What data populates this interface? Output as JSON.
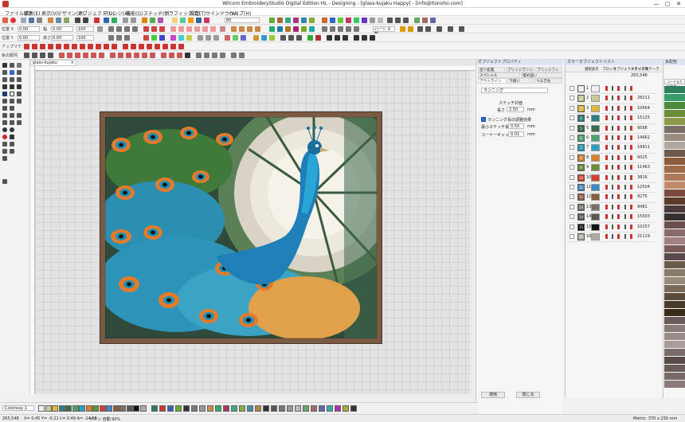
{
  "window": {
    "title": "Wilcom EmbroideryStudio Digital Edition HL - Designing - [glass-kujaku       Happy] - [info@itonoho.com]",
    "minimize": "—",
    "maximize": "▢",
    "close": "✕"
  },
  "menu": [
    "ファイル(F)",
    "編集(E)",
    "表示(V)",
    "デザイン(D)",
    "オブジェクト(O)",
    "アレンジ(A)",
    "機能(G)",
    "ステッチ(S)",
    "グラフィック(Q)",
    "設定(T)",
    "ウインドウ(W)",
    "ヘルプ(H)"
  ],
  "toolbar": {
    "pos_x_label": "位置 X",
    "pos_x_value": "0.00",
    "pos_y_label": "位置 Y",
    "pos_y_value": "0.00",
    "width_label": "幅",
    "width_value": "0.00",
    "height_label": "高さ",
    "height_value": "0.00",
    "zoom_value": "80",
    "applique_label": "アップリケ",
    "threadlist_label": "糸の順列",
    "x_axis_field": "ハート X 軸"
  },
  "document": {
    "tab_name": "glass-kujaku"
  },
  "properties_panel": {
    "title": "オブジェクトプロパティ",
    "tabs_row1": [
      "塗り処理",
      "ブリッジランニング",
      "ブリッジフィル"
    ],
    "tabs_row2": [
      "スペシャル",
      "埋め設い"
    ],
    "tabs_row3": [
      "アウトライン",
      "下縫い",
      "つなぎ糸"
    ],
    "stitch_type": "ランニング",
    "stitch_length_label": "ステッチ対値",
    "length_label": "長さ",
    "length_value": "2.50",
    "length_unit": "mm",
    "auto_adjust_label": "ランニング長の調整効果",
    "min_stitch_label": "最小ステッチ長",
    "min_stitch_value": "0.50",
    "corner_gap_label": "コーナーギャップ",
    "corner_gap_value": "0.01",
    "apply_button": "適用",
    "close_button": "閉じる"
  },
  "color_object_list": {
    "title": "カラーオブジェクトリスト",
    "columns": [
      "選択表示",
      "ブロック",
      "オブジェクトタイプ",
      "ステッチ数",
      "ステーラ"
    ],
    "total": "265,548",
    "rows": [
      {
        "n": "1",
        "color": "#efefef",
        "count": ""
      },
      {
        "n": "2",
        "color": "#c9c99a",
        "count": "28211"
      },
      {
        "n": "3",
        "color": "#e0b93a",
        "count": "10664"
      },
      {
        "n": "4",
        "color": "#2d7f7f",
        "count": "15125"
      },
      {
        "n": "5",
        "color": "#3a6a49",
        "count": "9588"
      },
      {
        "n": "6",
        "color": "#4aa26e",
        "count": "14662"
      },
      {
        "n": "7",
        "color": "#2b9fbf",
        "count": "16811"
      },
      {
        "n": "8",
        "color": "#d9822b",
        "count": "6025"
      },
      {
        "n": "9",
        "color": "#6b8d38",
        "count": "11463"
      },
      {
        "n": "10",
        "color": "#d2412a",
        "count": "3816"
      },
      {
        "n": "11",
        "color": "#3d89c6",
        "count": "12504"
      },
      {
        "n": "12",
        "color": "#8b5c3c",
        "count": "9275"
      },
      {
        "n": "13",
        "color": "#7a6f66",
        "count": "9481"
      },
      {
        "n": "14",
        "color": "#5c5650",
        "count": "15503"
      },
      {
        "n": "15",
        "color": "#111111",
        "count": "10157"
      },
      {
        "n": "16",
        "color": "#b0a9a1",
        "count": "21119"
      }
    ]
  },
  "right_panel": {
    "title": "糸配色",
    "search_placeholder": "コードまたは名前"
  },
  "bottom": {
    "colorway_label": "Colorway 1",
    "status_stitches": "265,548",
    "status_coords": "X= 0.45 Y= -0.21 L= 0.49 A= -24.55",
    "status_mode": "サテン 自動 90%",
    "status_size": "Metric: 370 x 230 mm"
  }
}
